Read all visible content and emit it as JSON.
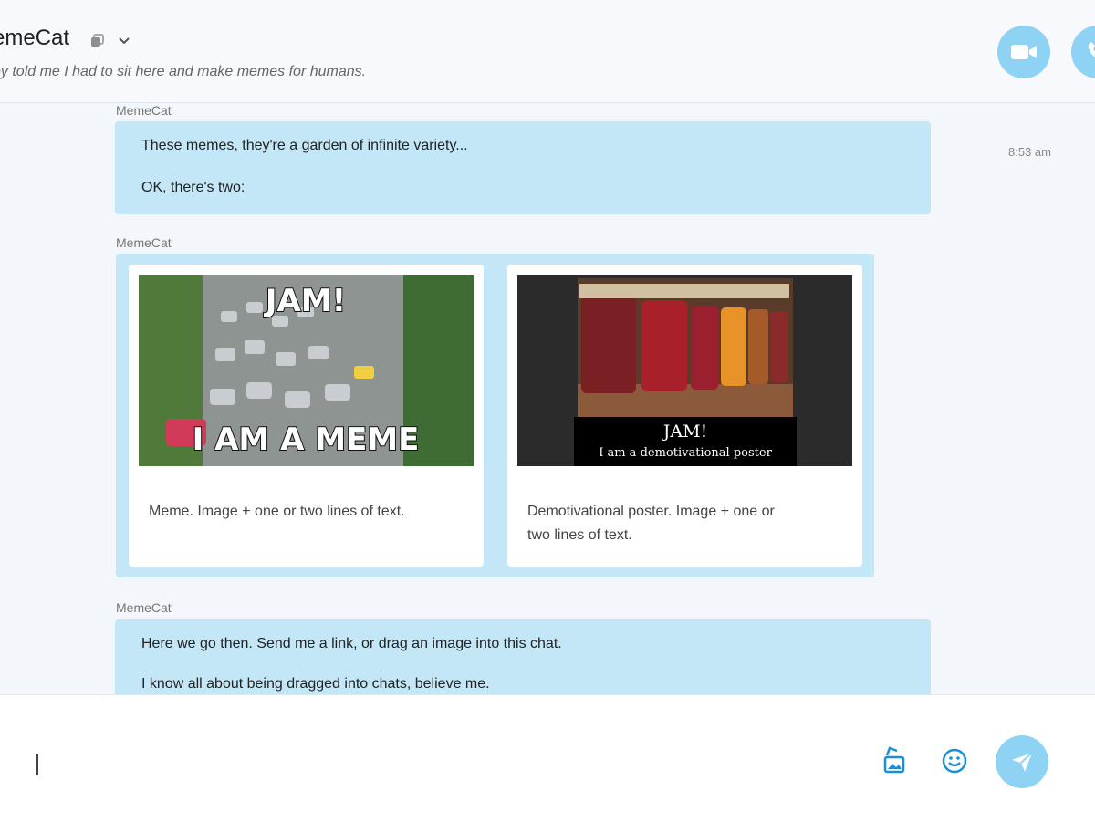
{
  "header": {
    "contact_name": "emeCat",
    "mood_message": "ey told me I had to sit here and make memes for humans.",
    "icons": [
      "copy-icon",
      "chevron-down-icon",
      "video-call-icon",
      "audio-call-icon"
    ]
  },
  "messages": [
    {
      "sender": "MemeCat",
      "lines": [
        "These memes, they're a garden of infinite variety...",
        "OK, there's two:"
      ],
      "time": "8:53 am"
    },
    {
      "sender": "MemeCat",
      "cards": [
        {
          "image_top_text": "JAM!",
          "image_bottom_text": "I AM A MEME",
          "caption_lines": [
            "Meme. Image + one or two lines of text."
          ]
        },
        {
          "image_top_text": "JAM!",
          "image_bottom_text": "I am a demotivational poster",
          "caption_lines": [
            "Demotivational poster. Image + one or",
            "two lines of text."
          ]
        }
      ]
    },
    {
      "sender": "MemeCat",
      "lines": [
        "Here we go then. Send me a link, or drag an image into this chat.",
        "I know all about being dragged into chats, believe me."
      ]
    }
  ],
  "composer": {
    "icons": [
      "media-icon",
      "emoji-icon",
      "send-icon"
    ]
  },
  "colors": {
    "accent": "#8fd3f4",
    "bubble": "#c4e7f7",
    "background": "#f3f6fa"
  }
}
